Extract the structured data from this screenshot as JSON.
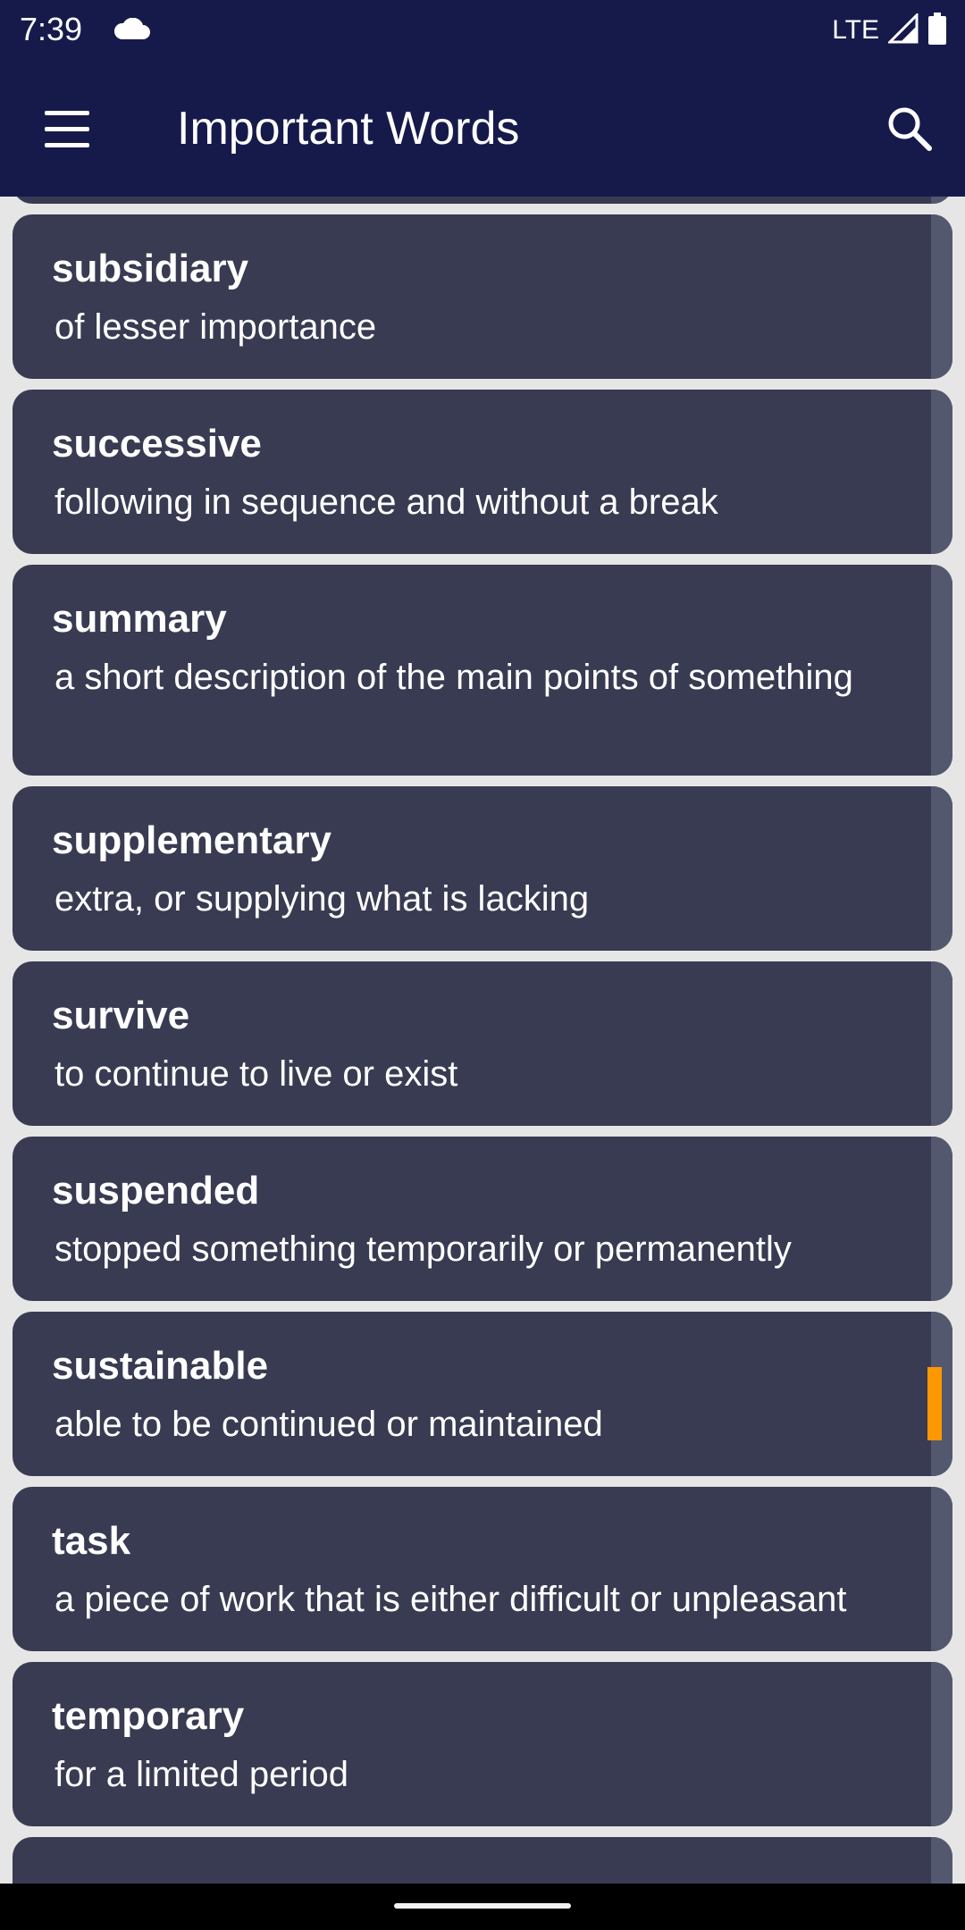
{
  "status_bar": {
    "time": "7:39",
    "network": "LTE",
    "icons": [
      "cloud-icon",
      "signal-icon",
      "battery-icon"
    ]
  },
  "app_bar": {
    "title": "Important Words",
    "menu_icon": "menu-icon",
    "search_icon": "search-icon"
  },
  "words": [
    {
      "word": "subsidiary",
      "definition": "of lesser importance"
    },
    {
      "word": "successive",
      "definition": "following in sequence and without a break"
    },
    {
      "word": "summary",
      "definition": "a short description of the main points of something"
    },
    {
      "word": "supplementary",
      "definition": "extra, or supplying what is lacking"
    },
    {
      "word": "survive",
      "definition": "to continue to live or exist"
    },
    {
      "word": "suspended",
      "definition": "stopped something temporarily or permanently"
    },
    {
      "word": "sustainable",
      "definition": "able to be continued or maintained"
    },
    {
      "word": "task",
      "definition": "a piece of work that is either difficult or unpleasant"
    },
    {
      "word": "temporary",
      "definition": "for a limited period"
    }
  ],
  "colors": {
    "app_bar": "#161a4b",
    "card": "#383b51",
    "background": "#e6e6e6",
    "scroll_thumb": "#ff9800"
  }
}
